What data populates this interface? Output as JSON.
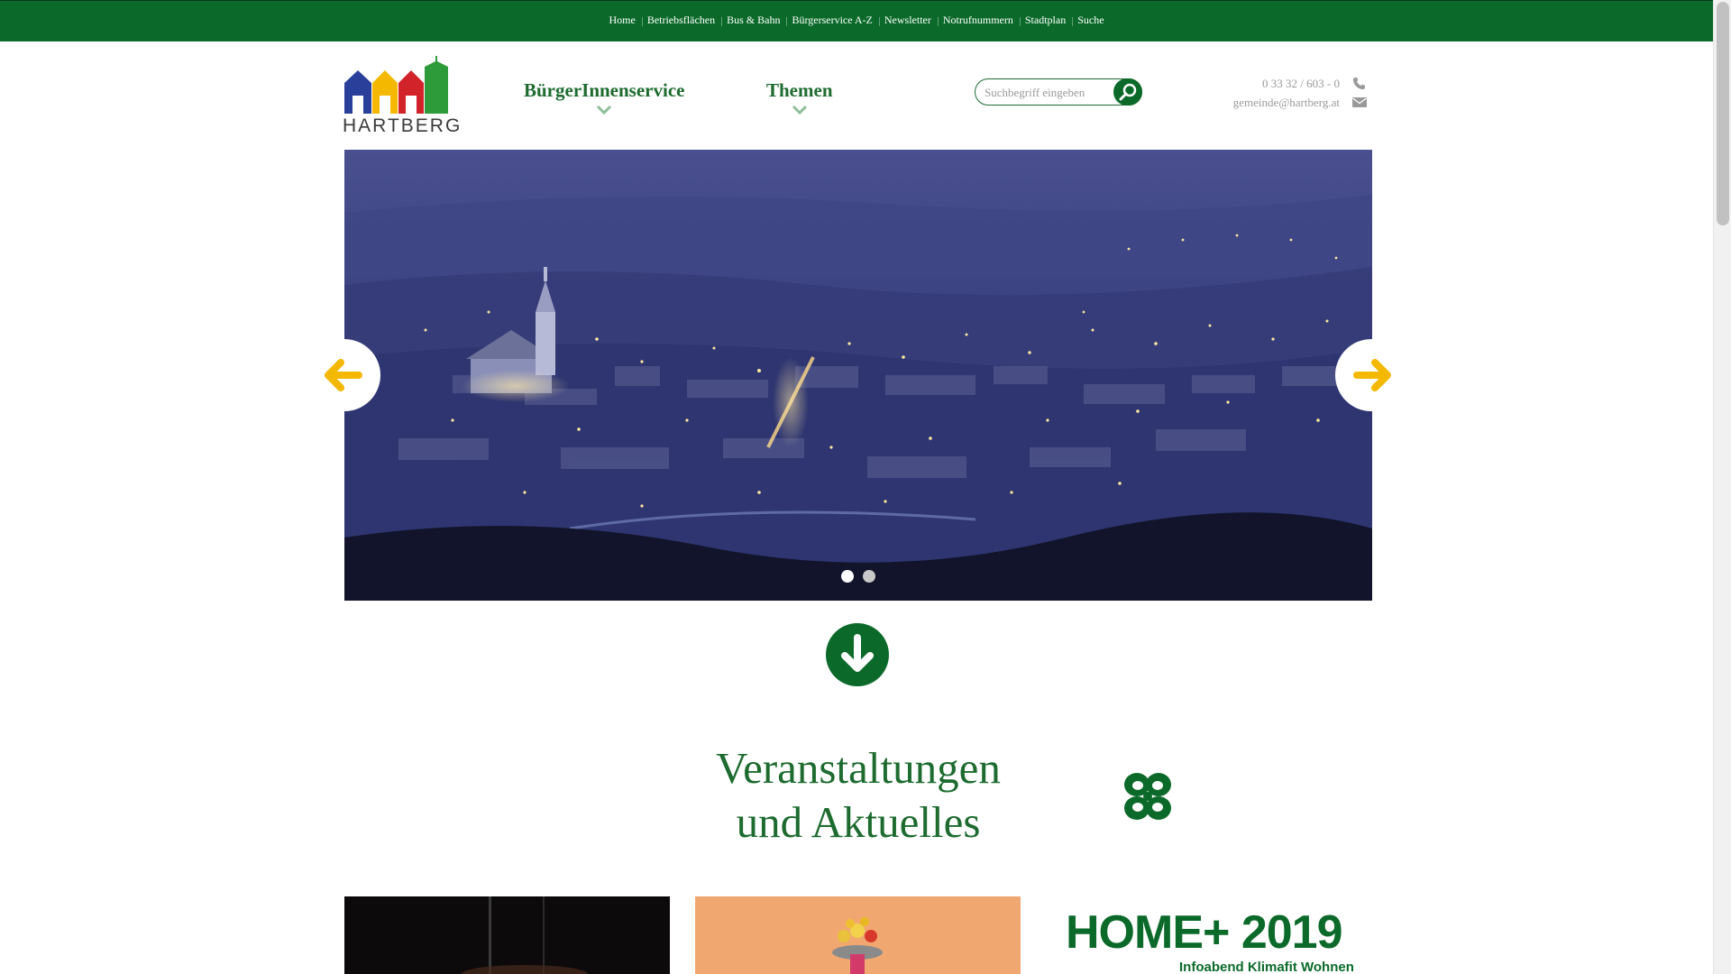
{
  "top_nav": {
    "items": [
      "Home",
      "Betriebsflächen",
      "Bus & Bahn",
      "Bürgerservice A-Z",
      "Newsletter",
      "Notrufnummern",
      "Stadtplan",
      "Suche"
    ]
  },
  "logo": {
    "text": "HARTBERG"
  },
  "main_nav": {
    "buergerinnenservice": "BürgerInnenservice",
    "themen": "Themen"
  },
  "search": {
    "placeholder": "Suchbegriff eingeben",
    "value": ""
  },
  "contact": {
    "phone": "0 33 32 / 603 - 0",
    "email": "gemeinde@hartberg.at"
  },
  "slider": {
    "slide_count": 2,
    "active_slide": 1
  },
  "section": {
    "title_line1": "Veranstaltungen",
    "title_line2": "und Aktuelles"
  },
  "cards": {
    "card3_title": "HOME+ 2019",
    "card3_subtitle": "Infoabend Klimafit Wohnen"
  },
  "colors": {
    "brand_green": "#0b6a2a",
    "accent_yellow": "#f5b800",
    "text_grey": "#9a9a9a"
  }
}
